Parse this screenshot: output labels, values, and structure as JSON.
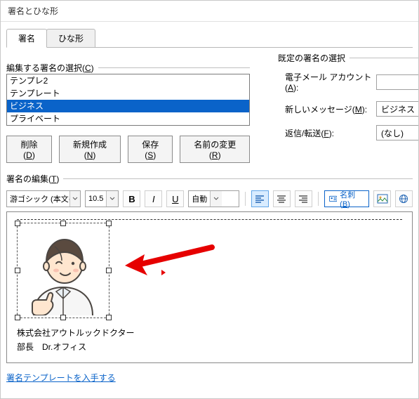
{
  "title": "署名とひな形",
  "tabs": {
    "t1": "署名",
    "t2": "ひな形"
  },
  "select_sig_label": "編集する署名の選択(C)",
  "default_sig_label": "既定の署名の選択",
  "list": [
    "テンプレ2",
    "テンプレート",
    "ビジネス",
    "プライベート"
  ],
  "buttons": {
    "del": "削除(D)",
    "new": "新規作成(N)",
    "save": "保存(S)",
    "rename": "名前の変更(R)"
  },
  "defaults": {
    "account_label": "電子メール アカウント(A):",
    "newmsg_label": "新しいメッセージ(M):",
    "reply_label": "返信/転送(F):",
    "newmsg_value": "ビジネス",
    "reply_value": "(なし)"
  },
  "edit_label": "署名の編集(T)",
  "font_name": "游ゴシック (本文の",
  "font_size": "10.5",
  "auto_color": "自動",
  "card_btn": "名刺(B)",
  "sig_line1": "株式会社アウトルックドクター",
  "sig_line2": "部長　Dr.オフィス",
  "web_link": "署名テンプレートを入手する"
}
